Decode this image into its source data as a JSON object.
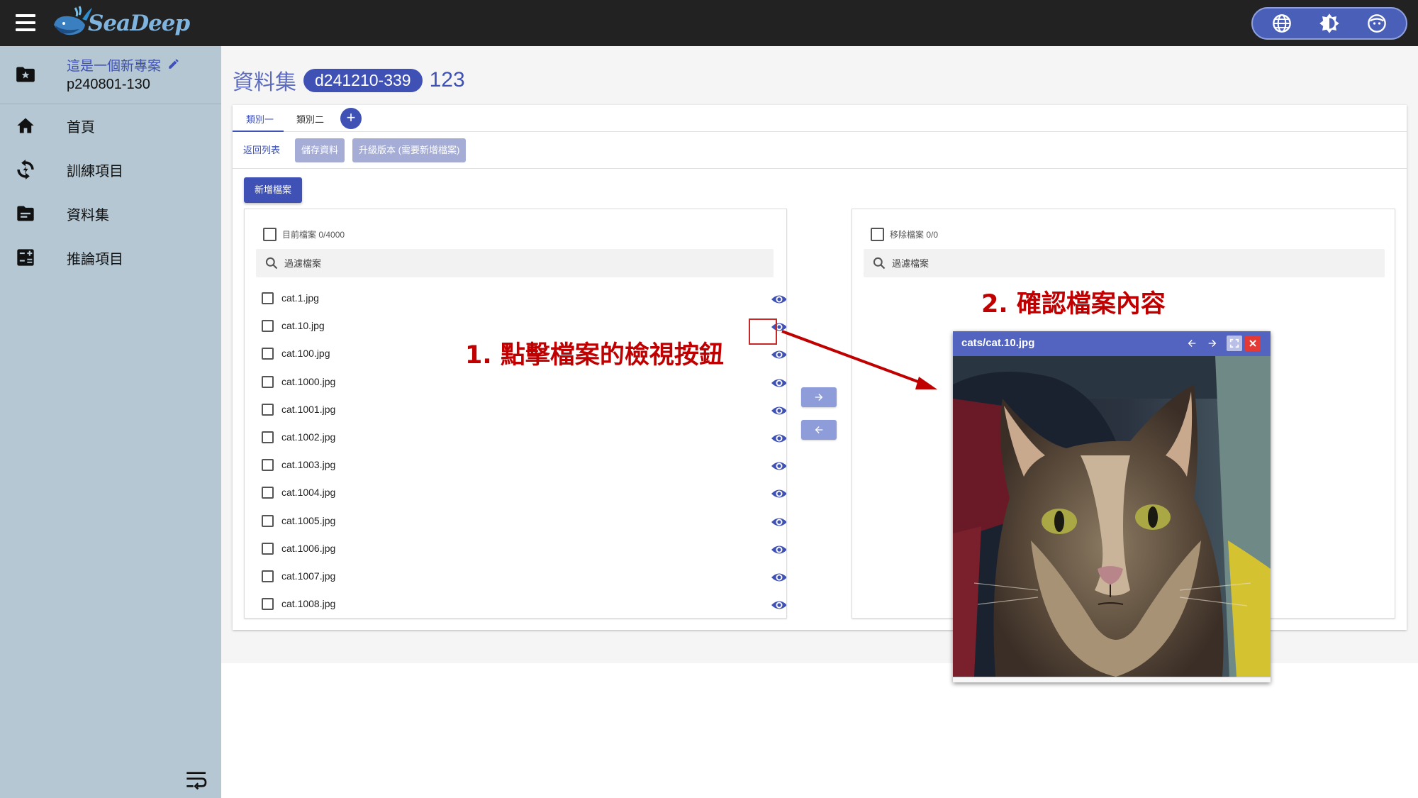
{
  "app": {
    "logo_text": "SeaDeep",
    "icons": {
      "menu": "hamburger-icon",
      "language": "globe-icon",
      "theme": "brightness-icon",
      "account": "face-icon"
    }
  },
  "sidebar": {
    "project_name": "這是一個新專案",
    "project_id": "p240801-130",
    "items": [
      {
        "label": "首頁",
        "icon": "home-icon"
      },
      {
        "label": "訓練項目",
        "icon": "training-icon"
      },
      {
        "label": "資料集",
        "icon": "dataset-icon"
      },
      {
        "label": "推論項目",
        "icon": "inference-icon"
      }
    ]
  },
  "page": {
    "title": "資料集",
    "dataset_id": "d241210-339",
    "dataset_name": "123"
  },
  "tabs": [
    {
      "label": "類別一",
      "active": true
    },
    {
      "label": "類別二",
      "active": false
    }
  ],
  "toolbar": {
    "back": "返回列表",
    "save": "儲存資料",
    "upgrade": "升級版本 (需要新增檔案)"
  },
  "add_file_button": "新增檔案",
  "left_panel": {
    "title": "目前檔案 0/4000",
    "search_placeholder": "過濾檔案",
    "files": [
      "cat.1.jpg",
      "cat.10.jpg",
      "cat.100.jpg",
      "cat.1000.jpg",
      "cat.1001.jpg",
      "cat.1002.jpg",
      "cat.1003.jpg",
      "cat.1004.jpg",
      "cat.1005.jpg",
      "cat.1006.jpg",
      "cat.1007.jpg",
      "cat.1008.jpg"
    ]
  },
  "right_panel": {
    "title": "移除檔案 0/0",
    "search_placeholder": "過濾檔案"
  },
  "annotations": {
    "step1": "1. 點擊檔案的檢視按鈕",
    "step2": "2. 確認檔案內容",
    "color": "#c00000"
  },
  "viewer": {
    "title": "cats/cat.10.jpg"
  },
  "colors": {
    "primary": "#3f51b5",
    "topbar": "#222222",
    "sidebar": "#b5c7d3",
    "disabled_button": "#a5acd6"
  }
}
